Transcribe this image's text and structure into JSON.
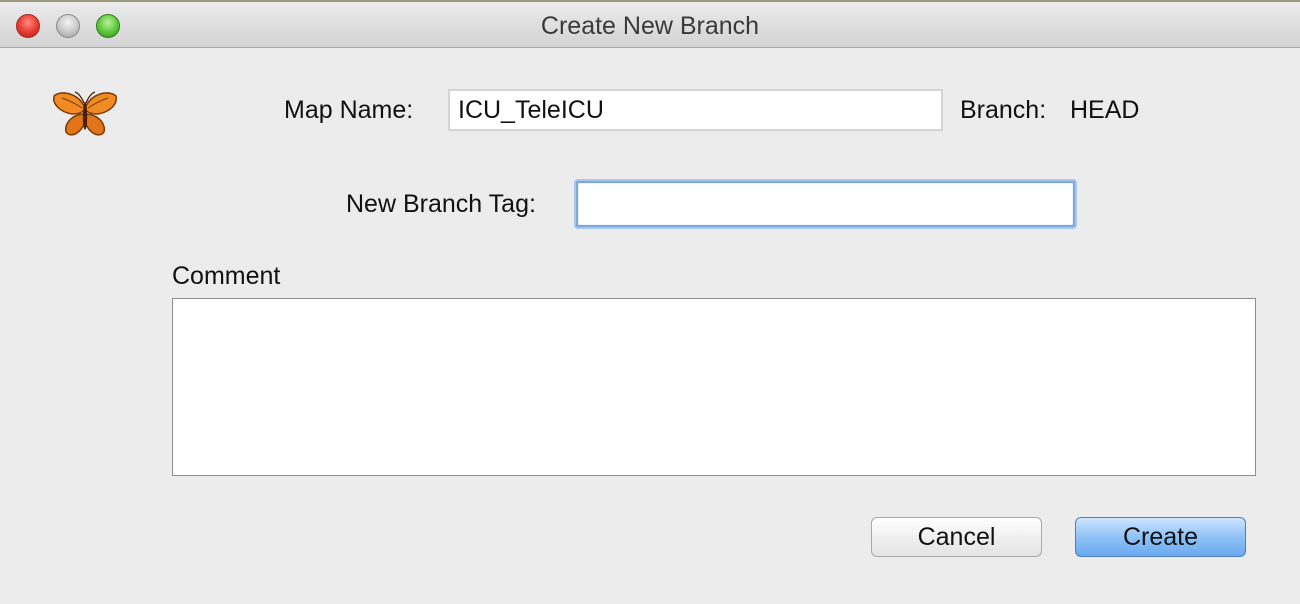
{
  "window": {
    "title": "Create New Branch"
  },
  "form": {
    "map_name_label": "Map Name:",
    "map_name_value": "ICU_TeleICU",
    "branch_label": "Branch:",
    "branch_value": "HEAD",
    "new_branch_tag_label": "New Branch Tag:",
    "new_branch_tag_value": "",
    "comment_label": "Comment",
    "comment_value": ""
  },
  "buttons": {
    "cancel_label": "Cancel",
    "create_label": "Create"
  },
  "icons": {
    "app_icon": "butterfly-icon",
    "close": "close-icon",
    "minimize": "minimize-icon",
    "zoom": "zoom-icon"
  },
  "colors": {
    "default_button": "#8fc2f7",
    "focus_ring": "#a9c6ee"
  }
}
